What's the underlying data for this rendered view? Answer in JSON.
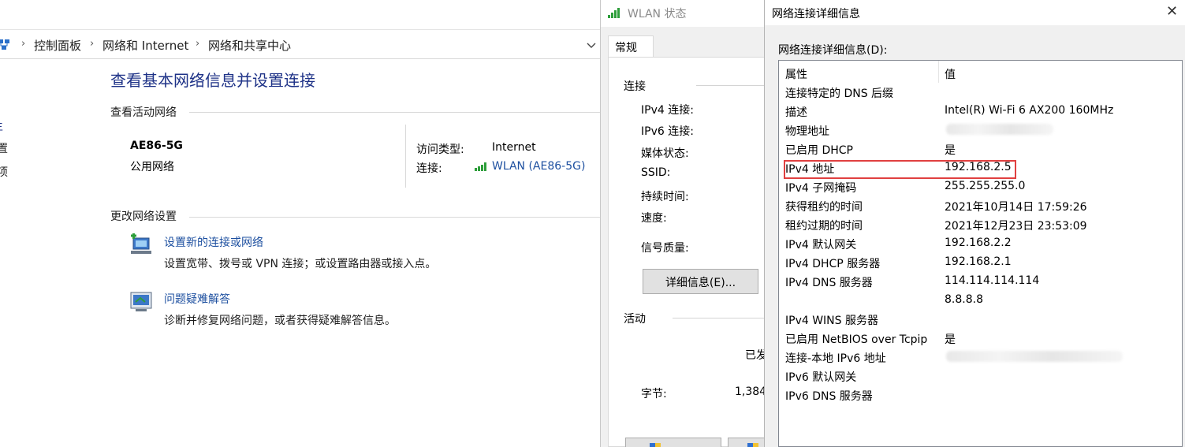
{
  "control_panel": {
    "breadcrumb": [
      "控制面板",
      "网络和 Internet",
      "网络和共享中心"
    ],
    "title": "查看基本网络信息并设置连接",
    "active_networks_label": "查看活动网络",
    "sidebar_fragments": [
      "置",
      "项"
    ],
    "network": {
      "name": "AE86-5G",
      "type": "公用网络",
      "access_type_label": "访问类型:",
      "access_type_value": "Internet",
      "connection_label": "连接:",
      "connection_value": "WLAN (AE86-5G)"
    },
    "change_settings_label": "更改网络设置",
    "tasks": [
      {
        "link": "设置新的连接或网络",
        "desc": "设置宽带、拨号或 VPN 连接；或设置路由器或接入点。"
      },
      {
        "link": "问题疑难解答",
        "desc": "诊断并修复网络问题，或者获得疑难解答信息。"
      }
    ]
  },
  "wlan_status": {
    "title": "WLAN 状态",
    "tab": "常规",
    "connection_group": "连接",
    "labels": [
      "IPv4 连接:",
      "IPv6 连接:",
      "媒体状态:",
      "SSID:",
      "持续时间:",
      "速度:"
    ],
    "signal_quality": "信号质量:",
    "details_button": "详细信息(E)...",
    "activity_group": "活动",
    "sent_partial": "已发",
    "bytes_label": "字节:",
    "bytes_partial": "1,384"
  },
  "details": {
    "title": "网络连接详细信息",
    "list_label": "网络连接详细信息(D):",
    "columns": {
      "property": "属性",
      "value": "值"
    },
    "rows": [
      {
        "p": "连接特定的 DNS 后缀",
        "v": ""
      },
      {
        "p": "描述",
        "v": "Intel(R) Wi-Fi 6 AX200 160MHz"
      },
      {
        "p": "物理地址",
        "v": ""
      },
      {
        "p": "已启用 DHCP",
        "v": "是"
      },
      {
        "p": "IPv4 地址",
        "v": "192.168.2.5"
      },
      {
        "p": "IPv4 子网掩码",
        "v": "255.255.255.0"
      },
      {
        "p": "获得租约的时间",
        "v": "2021年10月14日 17:59:26"
      },
      {
        "p": "租约过期的时间",
        "v": "2021年12月23日 23:53:09"
      },
      {
        "p": "IPv4 默认网关",
        "v": "192.168.2.2"
      },
      {
        "p": "IPv4 DHCP 服务器",
        "v": "192.168.2.1"
      },
      {
        "p": "IPv4 DNS 服务器",
        "v": "114.114.114.114"
      },
      {
        "p": "",
        "v": "8.8.8.8"
      },
      {
        "p": "IPv4 WINS 服务器",
        "v": ""
      },
      {
        "p": "已启用 NetBIOS over Tcpip",
        "v": "是"
      },
      {
        "p": "连接-本地 IPv6 地址",
        "v": ""
      },
      {
        "p": "IPv6 默认网关",
        "v": ""
      },
      {
        "p": "IPv6 DNS 服务器",
        "v": ""
      }
    ],
    "highlighted_row": "IPv4 地址",
    "accent_color": "#e04040"
  },
  "colors": {
    "link": "#1e50a0",
    "title": "#1e3287"
  }
}
